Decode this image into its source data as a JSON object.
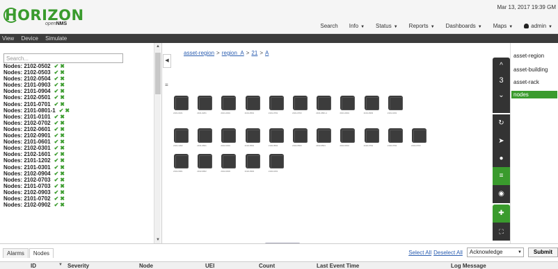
{
  "header": {
    "logo_text": "HORIZON",
    "logo_sub": "open",
    "logo_sub_bold": "NMS",
    "datetime": "Mar 13, 2017 19:39 GM",
    "nav": [
      {
        "label": "Search",
        "caret": false
      },
      {
        "label": "Info",
        "caret": true
      },
      {
        "label": "Status",
        "caret": true
      },
      {
        "label": "Reports",
        "caret": true
      },
      {
        "label": "Dashboards",
        "caret": true
      },
      {
        "label": "Maps",
        "caret": true
      },
      {
        "label": "admin",
        "caret": true,
        "icon": "user-icon"
      }
    ]
  },
  "menubar": [
    "View",
    "Device",
    "Simulate"
  ],
  "left": {
    "search_placeholder": "Search...",
    "nodes": [
      "Nodes: 2102-0502",
      "Nodes: 2102-0503",
      "Nodes: 2102-0504",
      "Nodes: 2101-0903",
      "Nodes: 2101-0904",
      "Nodes: 2102-0501",
      "Nodes: 2101-0701",
      "Nodes: 2101-0801-1",
      "Nodes: 2101-0101",
      "Nodes: 2102-0702",
      "Nodes: 2102-0601",
      "Nodes: 2102-0901",
      "Nodes: 2101-0601",
      "Nodes: 2102-0301",
      "Nodes: 2102-1601",
      "Nodes: 2101-1202",
      "Nodes: 2101-0301",
      "Nodes: 2102-0904",
      "Nodes: 2102-0703",
      "Nodes: 2101-0703",
      "Nodes: 2102-0903",
      "Nodes: 2101-0702",
      "Nodes: 2102-0902"
    ],
    "check_icon": "✔",
    "x_icon": "✖"
  },
  "breadcrumb": [
    "asset-region",
    "region_A",
    "21",
    "A"
  ],
  "map": {
    "row1": [
      "2101-0101",
      "2101-0201",
      "2101-0301",
      "2101-0501",
      "2101-0701",
      "2101-0703",
      "2101-0801-1",
      "2101-0901",
      "2101-0903",
      "2101-1001"
    ],
    "row2": [
      "2101-1202",
      "2101-0601",
      "2102-0301",
      "2102-0501",
      "2102-0502",
      "2102-0503",
      "2102-0504",
      "2102-0601",
      "2102-0701",
      "2102-0702",
      "2102-0703"
    ],
    "row3": [
      "2102-0901",
      "2102-0902",
      "2102-0903",
      "2102-0904",
      "2102-1601"
    ]
  },
  "controls": {
    "szl_level": "3",
    "up": "^",
    "down": "⌄"
  },
  "layers": [
    "asset-region",
    "asset-building",
    "asset-rack",
    "nodes"
  ],
  "bottom": {
    "tabs": [
      "Alarms",
      "Nodes"
    ],
    "select_all": "Select All",
    "deselect_all": "Deselect All",
    "ack_value": "Acknowledge",
    "submit": "Submit",
    "columns": [
      "ID",
      "Severity",
      "Node",
      "UEI",
      "Count",
      "Last Event Time",
      "Log Message"
    ]
  },
  "colors": {
    "brand_green": "#3a9b2d",
    "dark": "#333333",
    "link": "#2a5db0"
  }
}
